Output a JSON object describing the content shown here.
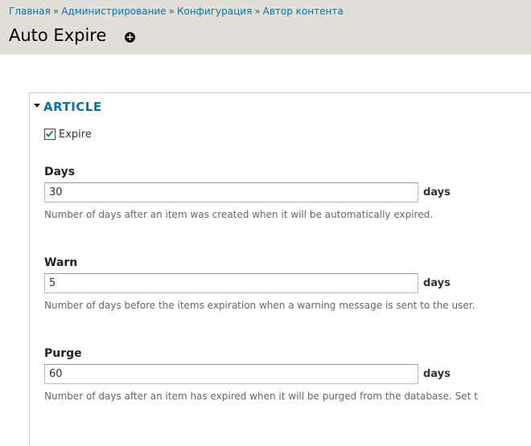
{
  "breadcrumb": {
    "items": [
      "Главная",
      "Администрирование",
      "Конфигурация",
      "Автор контента"
    ],
    "separator": "»"
  },
  "page": {
    "title": "Auto Expire",
    "add_icon": "plus-circle-icon"
  },
  "section": {
    "legend": "ARTICLE",
    "collapse_icon": "triangle-down-icon",
    "expire_checkbox": {
      "label": "Expire",
      "checked": true
    },
    "fields": [
      {
        "label": "Days",
        "value": "30",
        "suffix": "days",
        "description": "Number of days after an item was created when it will be automatically expired."
      },
      {
        "label": "Warn",
        "value": "5",
        "suffix": "days",
        "description": "Number of days before the items expiration when a warning message is sent to the user."
      },
      {
        "label": "Purge",
        "value": "60",
        "suffix": "days",
        "description": "Number of days after an item has expired when it will be purged from the database. Set t"
      }
    ]
  },
  "colors": {
    "header_bg": "#e0e0d8",
    "link": "#0074bd",
    "checkmark": "#1a8f1a"
  }
}
